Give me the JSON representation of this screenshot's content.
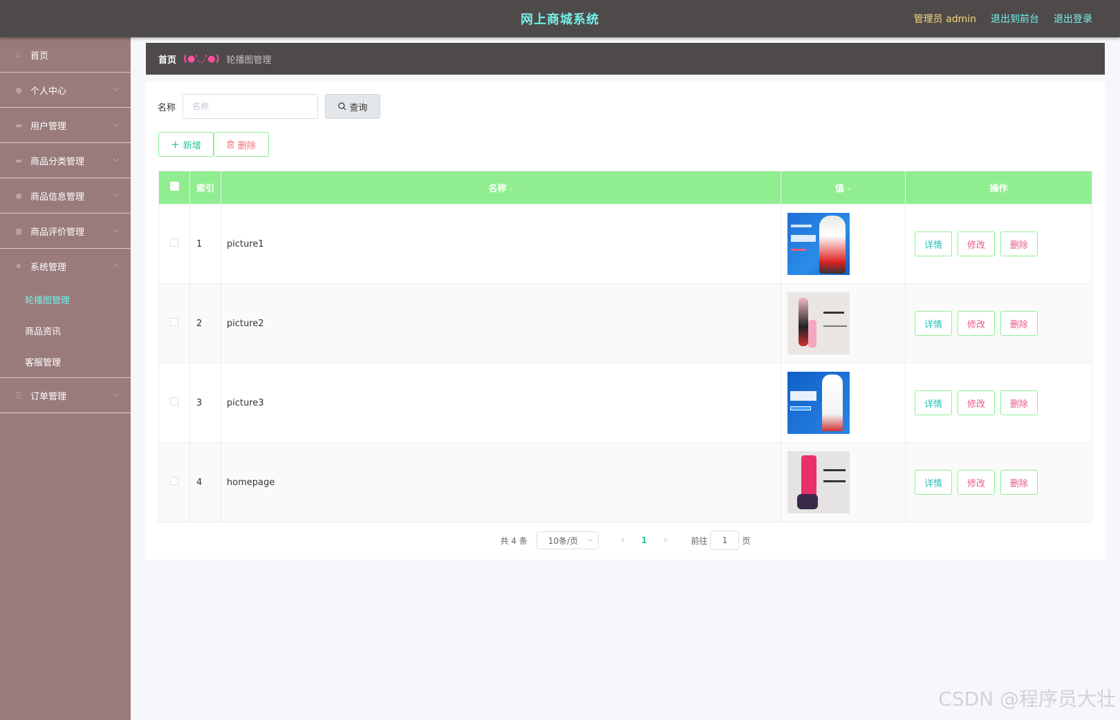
{
  "header": {
    "title": "网上商城系统",
    "admin_label": "管理员 admin",
    "to_front": "退出到前台",
    "logout": "退出登录"
  },
  "sidebar": {
    "items": [
      {
        "label": "首页",
        "icon": "home-icon"
      },
      {
        "label": "个人中心",
        "icon": "user-icon"
      },
      {
        "label": "用户管理",
        "icon": "list-icon"
      },
      {
        "label": "商品分类管理",
        "icon": "box-icon"
      },
      {
        "label": "商品信息管理",
        "icon": "user-icon"
      },
      {
        "label": "商品评价管理",
        "icon": "document-icon"
      },
      {
        "label": "系统管理",
        "icon": "gear-icon"
      },
      {
        "label": "订单管理",
        "icon": "menu-icon"
      }
    ],
    "sub_items": [
      {
        "label": "轮播图管理",
        "active": true
      },
      {
        "label": "商品资讯"
      },
      {
        "label": "客服管理"
      }
    ]
  },
  "breadcrumb": {
    "home": "首页",
    "separator": "(●'◡'●)",
    "current": "轮播图管理"
  },
  "search": {
    "label": "名称",
    "placeholder": "名称",
    "button": "查询"
  },
  "actions": {
    "add": "新增",
    "delete": "删除"
  },
  "table": {
    "columns": [
      "索引",
      "名称",
      "值",
      "操作"
    ],
    "rows": [
      {
        "index": "1",
        "name": "picture1"
      },
      {
        "index": "2",
        "name": "picture2"
      },
      {
        "index": "3",
        "name": "picture3"
      },
      {
        "index": "4",
        "name": "homepage"
      }
    ],
    "op_detail": "详情",
    "op_edit": "修改",
    "op_delete": "删除"
  },
  "pagination": {
    "total": "共 4 条",
    "page_size": "10条/页",
    "current_page": "1",
    "goto_label": "前往",
    "goto_value": "1",
    "page_suffix": "页"
  },
  "watermark": "CSDN @程序员大壮",
  "colors": {
    "accent": "#73f0ea",
    "header_bg": "#4f4a4a",
    "sidebar_bg": "#9a7b7b",
    "table_header": "#90ee90"
  }
}
